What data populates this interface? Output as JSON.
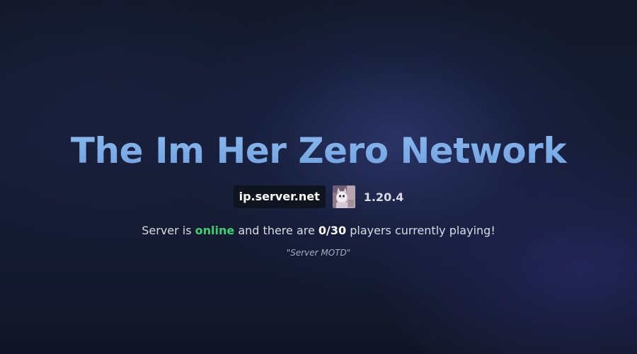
{
  "hero": {
    "title": "The Im Her Zero Network"
  },
  "server": {
    "ip": "ip.server.net",
    "icon": "server-icon-cat",
    "version": "1.20.4"
  },
  "status": {
    "prefix": "Server is ",
    "state": "online",
    "middle": " and there are ",
    "players": "0/30",
    "suffix": " players currently playing!"
  },
  "motd": {
    "text": "\"Server MOTD\""
  },
  "colors": {
    "title_gradient_top": "#8bbcf0",
    "title_gradient_bottom": "#6f9fde",
    "online": "#3bd16f",
    "background": "#141a30",
    "chip": "#10141f"
  }
}
